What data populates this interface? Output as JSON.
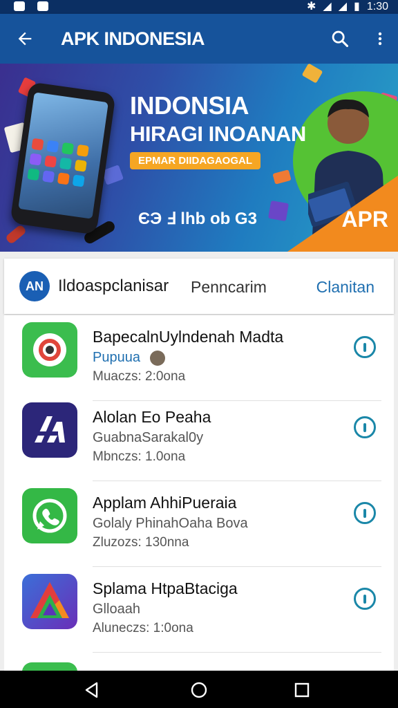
{
  "status_bar": {
    "time": "1:30"
  },
  "app_bar": {
    "title": "APK INDONESIA"
  },
  "banner": {
    "heading_1": "INDONSIA",
    "heading_2": "HIRAGI INOANAN",
    "pill": "EPMAR DIIDAGAOGAL",
    "footer": "ЄЭ Ⅎ lhb ob G3",
    "corner": "APR"
  },
  "card_header": {
    "avatar_text": "AN",
    "name": "Ildoaspclanisar",
    "subtitle": "Penncarim",
    "action": "Clanitan"
  },
  "apps": [
    {
      "title": "BapecalnUylndenah Madta",
      "subtitle": "Pupuua",
      "meta": "Muaczs: 2:0ona",
      "icon_color": "#3bbd4e"
    },
    {
      "title": "Alolan Eo Peaha",
      "subtitle": "GuabnaSarakal0y",
      "meta": "Mbnczs: 1.0ona",
      "icon_color": "#2c2679"
    },
    {
      "title": "Applam AhhiPueraia",
      "subtitle": "Golaly PhinahOaha Bova",
      "meta": "Zluzozs: 130nna",
      "icon_color": "#34b846"
    },
    {
      "title": "Splama HtpaBtaciga",
      "subtitle": "Glloaah",
      "meta": "Aluneczs: 1:0ona",
      "icon_color": "#5a35b8"
    }
  ],
  "colors": {
    "app_bar": "#16539b",
    "status_bar": "#0b2f63",
    "accent": "#1a87a8",
    "link": "#1f6fb0"
  }
}
